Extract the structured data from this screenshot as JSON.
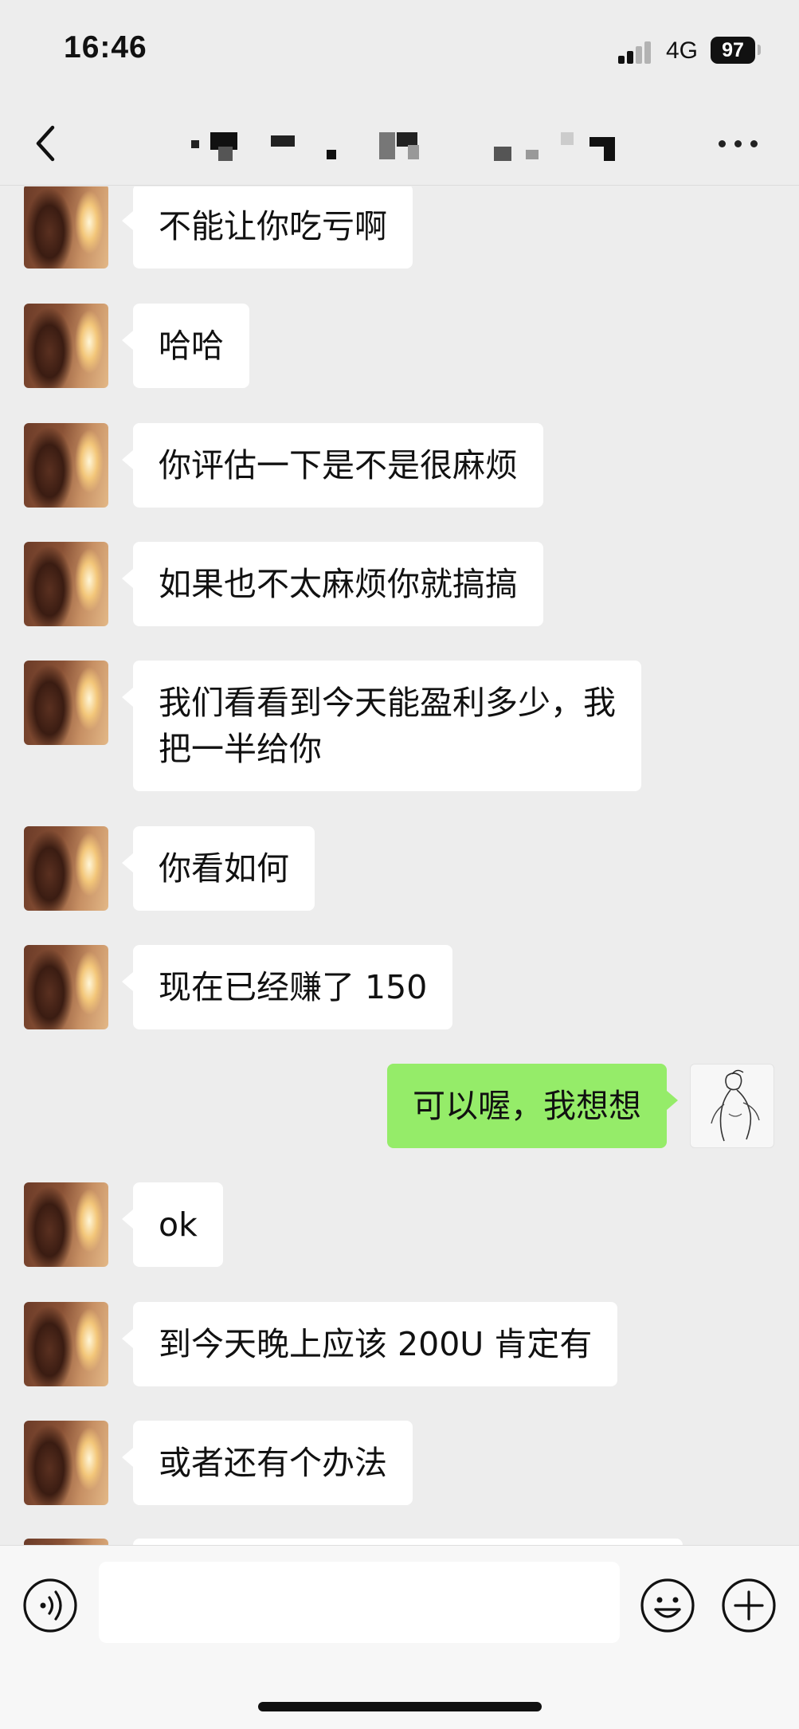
{
  "status_bar": {
    "time": "16:46",
    "network": "4G",
    "battery": "97"
  },
  "nav": {
    "title_redacted": true
  },
  "messages": [
    {
      "side": "them",
      "text": "不能让你吃亏啊"
    },
    {
      "side": "them",
      "text": "哈哈"
    },
    {
      "side": "them",
      "text": "你评估一下是不是很麻烦"
    },
    {
      "side": "them",
      "text": "如果也不太麻烦你就搞搞"
    },
    {
      "side": "them",
      "text": "我们看看到今天能盈利多少，我\n把一半给你"
    },
    {
      "side": "them",
      "text": "你看如何"
    },
    {
      "side": "them",
      "text": "现在已经赚了 150"
    },
    {
      "side": "me",
      "text": "可以喔，我想想"
    },
    {
      "side": "them",
      "text": "ok"
    },
    {
      "side": "them",
      "text": "到今天晚上应该 200U 肯定有"
    },
    {
      "side": "them",
      "text": "或者还有个办法"
    }
  ],
  "input": {
    "value": "",
    "placeholder": ""
  },
  "colors": {
    "background": "#ededed",
    "their_bubble": "#ffffff",
    "my_bubble": "#95ec69"
  },
  "icons": {
    "back": "chevron-left-icon",
    "more": "ellipsis-icon",
    "voice": "voice-icon",
    "emoji": "emoji-icon",
    "plus": "plus-icon"
  }
}
